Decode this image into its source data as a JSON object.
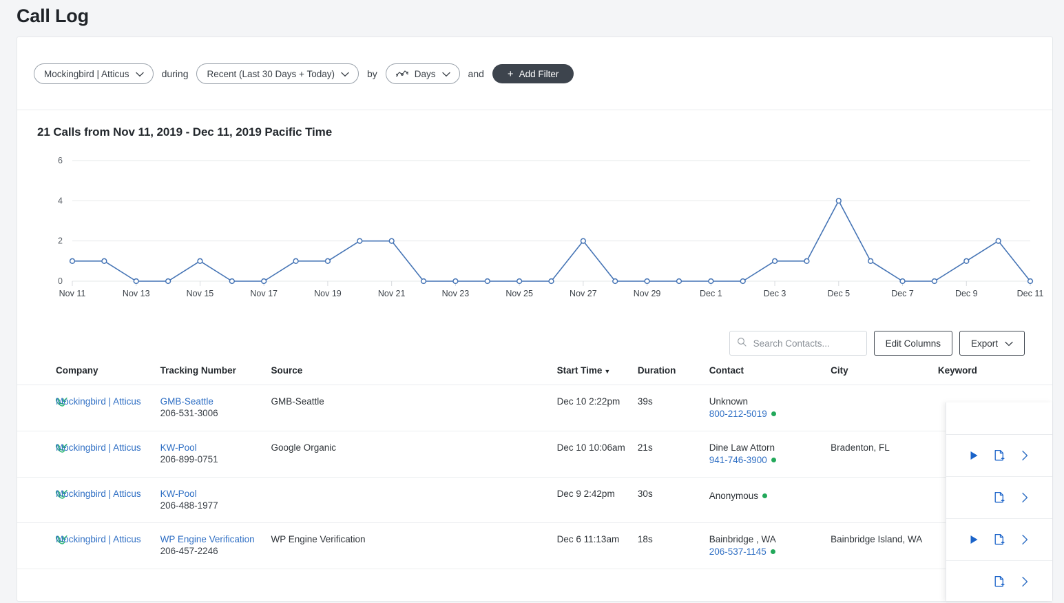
{
  "page": {
    "title": "Call Log"
  },
  "filters": {
    "company": {
      "label": "Mockingbird | Atticus",
      "icon": "chevron-down-icon"
    },
    "conj1": "during",
    "date_range": {
      "label": "Recent (Last 30 Days + Today)",
      "icon": "chevron-down-icon"
    },
    "conj2": "by",
    "granularity": {
      "label": "Days",
      "icon": "line-chart-icon"
    },
    "conj3": "and",
    "add_filter": {
      "label": "Add Filter",
      "icon": "plus-icon"
    }
  },
  "chart_data": {
    "type": "line",
    "title": "21 Calls from Nov 11, 2019 - Dec 11, 2019 Pacific Time",
    "xlabel": "",
    "ylabel": "",
    "ylim": [
      0,
      6
    ],
    "yticks": [
      0,
      2,
      4,
      6
    ],
    "grid": true,
    "legend": "none",
    "line_color": "#4574b5",
    "marker": "open-circle",
    "x": [
      "Nov 11",
      "Nov 12",
      "Nov 13",
      "Nov 14",
      "Nov 15",
      "Nov 16",
      "Nov 17",
      "Nov 18",
      "Nov 19",
      "Nov 20",
      "Nov 21",
      "Nov 22",
      "Nov 23",
      "Nov 24",
      "Nov 25",
      "Nov 26",
      "Nov 27",
      "Nov 28",
      "Nov 29",
      "Nov 30",
      "Dec 1",
      "Dec 2",
      "Dec 3",
      "Dec 4",
      "Dec 5",
      "Dec 6",
      "Dec 7",
      "Dec 8",
      "Dec 9",
      "Dec 10",
      "Dec 11"
    ],
    "xtick_labels": [
      "Nov 11",
      "Nov 13",
      "Nov 15",
      "Nov 17",
      "Nov 19",
      "Nov 21",
      "Nov 23",
      "Nov 25",
      "Nov 27",
      "Nov 29",
      "Dec 1",
      "Dec 3",
      "Dec 5",
      "Dec 7",
      "Dec 9",
      "Dec 11"
    ],
    "values": [
      1,
      1,
      0,
      0,
      1,
      0,
      0,
      1,
      1,
      2,
      2,
      0,
      0,
      0,
      0,
      0,
      2,
      0,
      0,
      0,
      0,
      0,
      1,
      1,
      4,
      1,
      0,
      0,
      1,
      2,
      0
    ],
    "total_calls": 21
  },
  "toolbar": {
    "search_placeholder": "Search Contacts...",
    "search_value": "",
    "search_icon": "search-icon",
    "edit_columns_label": "Edit Columns",
    "export_label": "Export",
    "export_icon": "chevron-down-icon"
  },
  "table": {
    "columns": [
      {
        "key": "icon",
        "label": ""
      },
      {
        "key": "company",
        "label": "Company"
      },
      {
        "key": "tracking",
        "label": "Tracking Number"
      },
      {
        "key": "source",
        "label": "Source"
      },
      {
        "key": "start_time",
        "label": "Start Time",
        "sorted": "desc",
        "sort_icon": "caret-down-icon"
      },
      {
        "key": "duration",
        "label": "Duration"
      },
      {
        "key": "contact",
        "label": "Contact"
      },
      {
        "key": "city",
        "label": "City"
      },
      {
        "key": "keyword",
        "label": "Keyword"
      }
    ],
    "rows": [
      {
        "direction_icon": "incoming-call-icon",
        "company": "Mockingbird | Atticus",
        "tracking_name": "GMB-Seattle",
        "tracking_number": "206-531-3006",
        "source": "GMB-Seattle",
        "start_time": "Dec 10 2:22pm",
        "duration": "39s",
        "contact_name": "Unknown",
        "contact_phone": "800-212-5019",
        "contact_status": "online",
        "city": "",
        "keyword": "",
        "has_play": true
      },
      {
        "direction_icon": "incoming-call-icon",
        "company": "Mockingbird | Atticus",
        "tracking_name": "KW-Pool",
        "tracking_number": "206-899-0751",
        "source": "Google Organic",
        "start_time": "Dec 10 10:06am",
        "duration": "21s",
        "contact_name": "Dine Law Attorn",
        "contact_phone": "941-746-3900",
        "contact_status": "online",
        "city": "Bradenton, FL",
        "keyword": "",
        "has_play": false
      },
      {
        "direction_icon": "incoming-call-icon",
        "company": "Mockingbird | Atticus",
        "tracking_name": "KW-Pool",
        "tracking_number": "206-488-1977",
        "source": "",
        "start_time": "Dec 9 2:42pm",
        "duration": "30s",
        "contact_name": "Anonymous",
        "contact_phone": "",
        "contact_status": "online",
        "city": "",
        "keyword": "",
        "has_play": true
      },
      {
        "direction_icon": "incoming-call-icon",
        "company": "Mockingbird | Atticus",
        "tracking_name": "WP Engine Verification",
        "tracking_number": "206-457-2246",
        "source": "WP Engine Verification",
        "start_time": "Dec 6 11:13am",
        "duration": "18s",
        "contact_name": "Bainbridge , WA",
        "contact_phone": "206-537-1145",
        "contact_status": "online",
        "city": "Bainbridge Island, WA",
        "keyword": "",
        "has_play": false
      }
    ],
    "row_actions": {
      "play_icon": "play-icon",
      "add_note_icon": "add-note-icon",
      "expand_icon": "chevron-right-icon"
    }
  },
  "colors": {
    "accent": "#2f6fc4",
    "chart_line": "#4574b5",
    "status_online": "#22a85a",
    "call_icon": "#2bb673",
    "dark_button": "#3d444d"
  }
}
